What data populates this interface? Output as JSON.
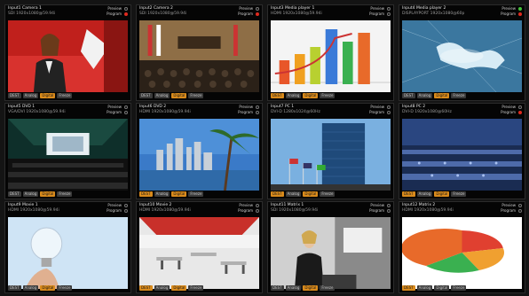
{
  "tiles": [
    {
      "t1": "Input1 Camera 1",
      "t2": "SDI 1920x1080@59.94i",
      "preview": "Preview",
      "program": "Program",
      "pv": "off",
      "pg": "red",
      "buttons": [
        {
          "label": "DEST",
          "active": false
        },
        {
          "label": "Analog",
          "active": false
        },
        {
          "label": "Digital",
          "active": true
        },
        {
          "label": "Freeze",
          "active": false
        }
      ],
      "scene": "anchor"
    },
    {
      "t1": "Input2 Camera 2",
      "t2": "SDI 1920x1080@59.94i",
      "preview": "Preview",
      "program": "Program",
      "pv": "off",
      "pg": "red",
      "buttons": [
        {
          "label": "DEST",
          "active": false
        },
        {
          "label": "Analog",
          "active": false
        },
        {
          "label": "Digital",
          "active": true
        },
        {
          "label": "Freeze",
          "active": false
        }
      ],
      "scene": "conference"
    },
    {
      "t1": "Input3 Media player 1",
      "t2": "HDMI 1920x1080@59.94i",
      "preview": "Preview",
      "program": "Program",
      "pv": "off",
      "pg": "off",
      "buttons": [
        {
          "label": "DEST",
          "active": true
        },
        {
          "label": "Analog",
          "active": false
        },
        {
          "label": "Digital",
          "active": true
        },
        {
          "label": "Freeze",
          "active": false
        }
      ],
      "scene": "bars3d"
    },
    {
      "t1": "Input4 Media player 2",
      "t2": "DISPLAYPORT 1920x1080@60p",
      "preview": "Preview",
      "program": "Program",
      "pv": "green",
      "pg": "red",
      "buttons": [
        {
          "label": "DEST",
          "active": false
        },
        {
          "label": "Analog",
          "active": false
        },
        {
          "label": "Digital",
          "active": true
        },
        {
          "label": "Freeze",
          "active": false
        }
      ],
      "scene": "worldmap"
    },
    {
      "t1": "Input5 DVD 1",
      "t2": "VGA/DVI 1920x1080@59.94i",
      "preview": "Preview",
      "program": "Program",
      "pv": "off",
      "pg": "off",
      "buttons": [
        {
          "label": "DEST",
          "active": false
        },
        {
          "label": "Analog",
          "active": false
        },
        {
          "label": "Digital",
          "active": true
        },
        {
          "label": "Freeze",
          "active": false
        }
      ],
      "scene": "auditorium"
    },
    {
      "t1": "Input6 DVD 2",
      "t2": "HDMI 1920x1080@59.94i",
      "preview": "Preview",
      "program": "Program",
      "pv": "off",
      "pg": "off",
      "buttons": [
        {
          "label": "DEST",
          "active": true
        },
        {
          "label": "Analog",
          "active": false
        },
        {
          "label": "Digital",
          "active": true
        },
        {
          "label": "Freeze",
          "active": false
        }
      ],
      "scene": "skyline"
    },
    {
      "t1": "Input7 PC 1",
      "t2": "DVI-D 1280x1024@60Hz",
      "preview": "Preview",
      "program": "Program",
      "pv": "off",
      "pg": "off",
      "buttons": [
        {
          "label": "DEST",
          "active": true
        },
        {
          "label": "Analog",
          "active": false
        },
        {
          "label": "Digital",
          "active": true
        },
        {
          "label": "Freeze",
          "active": false
        }
      ],
      "scene": "un"
    },
    {
      "t1": "Input8 PC 2",
      "t2": "DVI-D 1920x1080@60Hz",
      "preview": "Preview",
      "program": "Program",
      "pv": "off",
      "pg": "red",
      "buttons": [
        {
          "label": "DEST",
          "active": true
        },
        {
          "label": "Analog",
          "active": false
        },
        {
          "label": "Digital",
          "active": true
        },
        {
          "label": "Freeze",
          "active": false
        }
      ],
      "scene": "assembly"
    },
    {
      "t1": "Input9 Movie 1",
      "t2": "HDMI 1920x1080@59.94i",
      "preview": "Preview",
      "program": "Program",
      "pv": "off",
      "pg": "off",
      "buttons": [
        {
          "label": "DEST",
          "active": false
        },
        {
          "label": "Analog",
          "active": false
        },
        {
          "label": "Digital",
          "active": true
        },
        {
          "label": "Freeze",
          "active": false
        }
      ],
      "scene": "bulb"
    },
    {
      "t1": "Input10 Movie 2",
      "t2": "HDMI 1920x1080@59.94i",
      "preview": "Preview",
      "program": "Program",
      "pv": "off",
      "pg": "off",
      "buttons": [
        {
          "label": "DEST",
          "active": true
        },
        {
          "label": "Analog",
          "active": false
        },
        {
          "label": "Digital",
          "active": true
        },
        {
          "label": "Freeze",
          "active": false
        }
      ],
      "scene": "office"
    },
    {
      "t1": "Input11 Matrix 1",
      "t2": "SDI 1920x1080@59.94i",
      "preview": "Preview",
      "program": "Program",
      "pv": "off",
      "pg": "off",
      "buttons": [
        {
          "label": "DEST",
          "active": false
        },
        {
          "label": "Analog",
          "active": false
        },
        {
          "label": "Digital",
          "active": true
        },
        {
          "label": "Freeze",
          "active": false
        }
      ],
      "scene": "presenter"
    },
    {
      "t1": "Input12 Matrix 2",
      "t2": "HDMI 1920x1080@59.94i",
      "preview": "Preview",
      "program": "Program",
      "pv": "off",
      "pg": "off",
      "buttons": [
        {
          "label": "DEST",
          "active": true
        },
        {
          "label": "Analog",
          "active": false
        },
        {
          "label": "Digital",
          "active": false
        },
        {
          "label": "Freeze",
          "active": false
        }
      ],
      "scene": "pie3d"
    }
  ]
}
